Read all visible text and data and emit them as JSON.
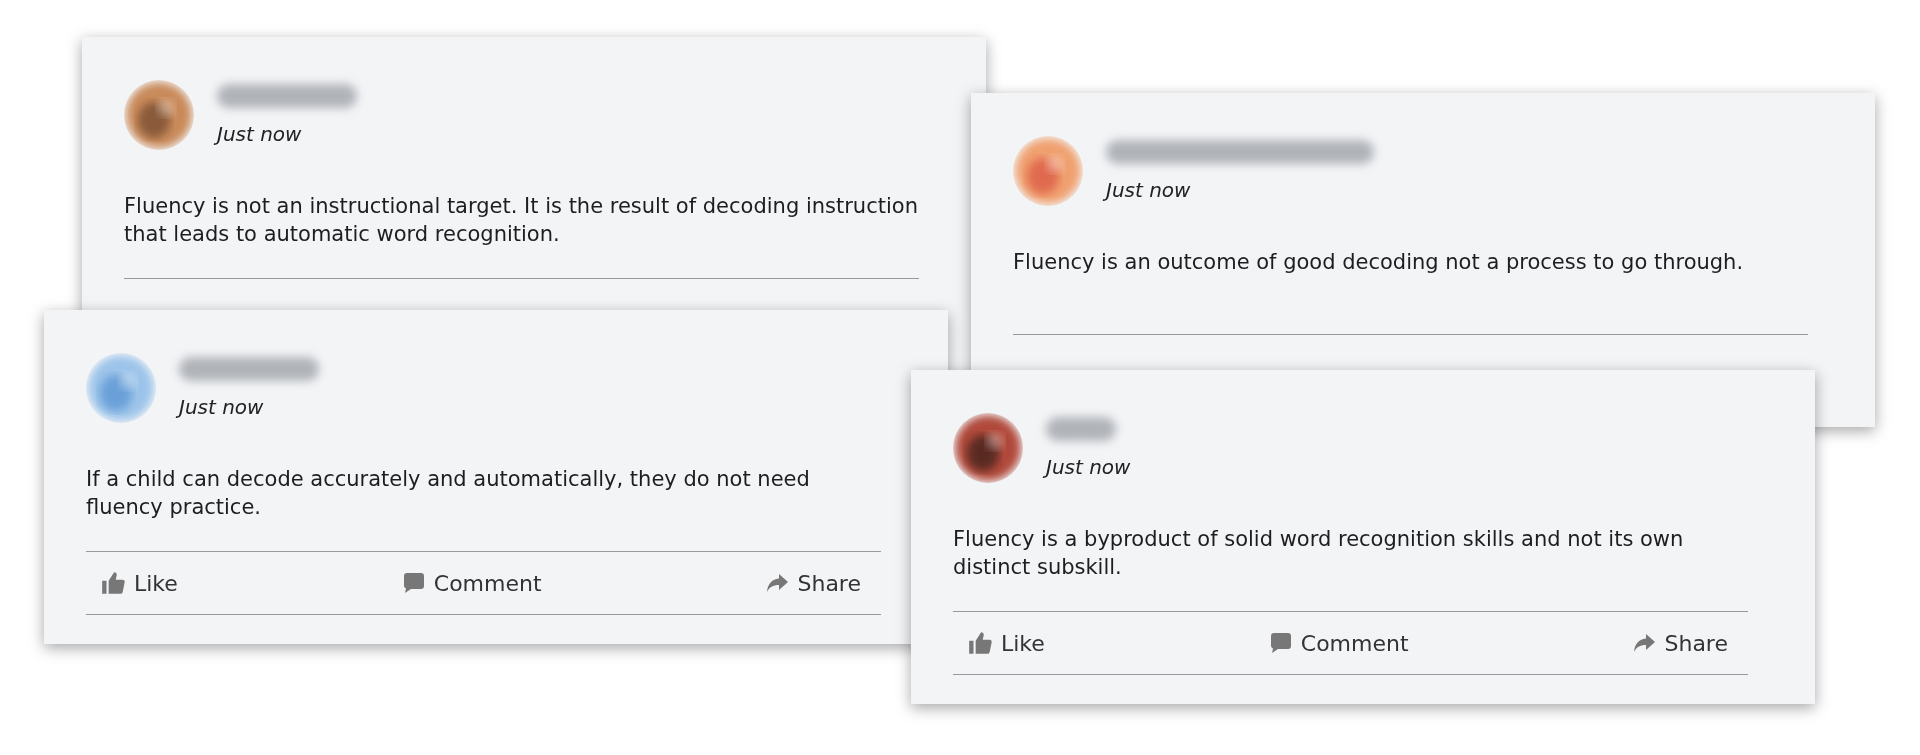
{
  "posts": [
    {
      "time": "Just now",
      "text_lines": [
        "Fluency is not an instructional target. It is the result of decoding instruction",
        "that leads to automatic word recognition."
      ]
    },
    {
      "time": "Just now",
      "text_lines": [
        "Fluency is an outcome of good decoding not a process to go through."
      ]
    },
    {
      "time": "Just now",
      "text_lines": [
        "If a child can decode accurately and automatically, they do not need",
        "fluency practice."
      ],
      "actions": [
        {
          "kind": "like",
          "label": "Like"
        },
        {
          "kind": "comment",
          "label": "Comment"
        },
        {
          "kind": "share",
          "label": "Share"
        }
      ]
    },
    {
      "time": "Just now",
      "text_lines": [
        "Fluency is a byproduct of solid word recognition skills and not its own",
        "distinct subskill."
      ],
      "actions": [
        {
          "kind": "like",
          "label": "Like"
        },
        {
          "kind": "comment",
          "label": "Comment"
        },
        {
          "kind": "share",
          "label": "Share"
        }
      ]
    }
  ]
}
